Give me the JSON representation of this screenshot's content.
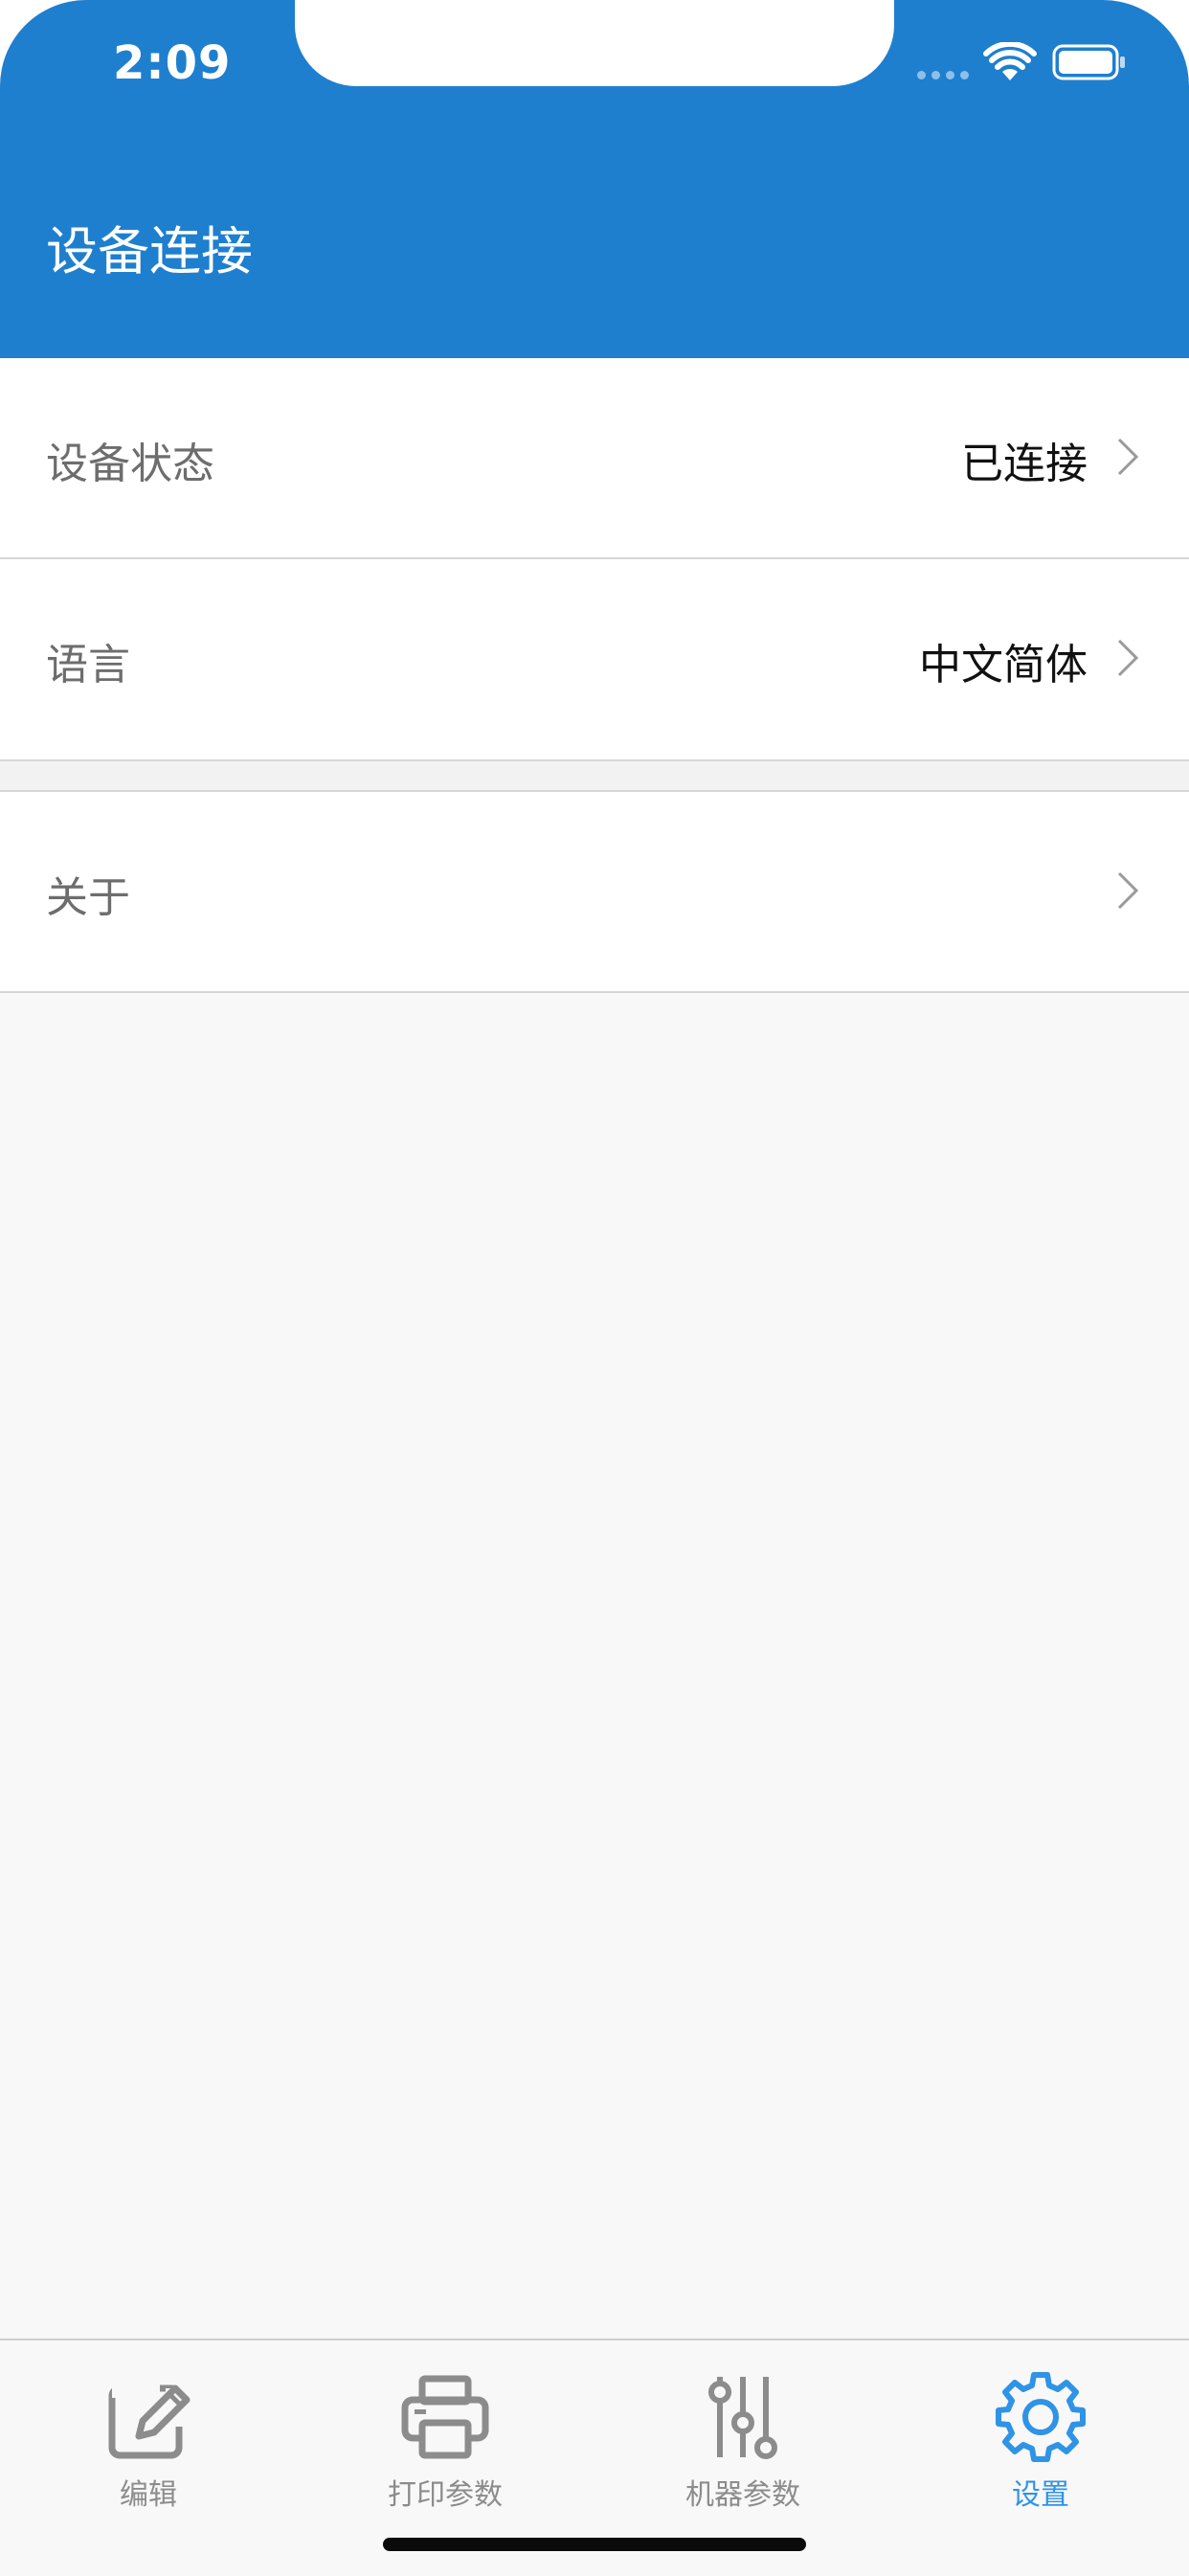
{
  "status_bar": {
    "time": "2:09"
  },
  "header": {
    "title": "设备连接"
  },
  "settings": {
    "rows": [
      {
        "label": "设备状态",
        "value": "已连接"
      },
      {
        "label": "语言",
        "value": "中文简体"
      },
      {
        "label": "关于",
        "value": ""
      }
    ]
  },
  "tabbar": {
    "tabs": [
      {
        "label": "编辑",
        "icon": "edit-icon",
        "active": false
      },
      {
        "label": "打印参数",
        "icon": "printer-icon",
        "active": false
      },
      {
        "label": "机器参数",
        "icon": "sliders-icon",
        "active": false
      },
      {
        "label": "设置",
        "icon": "gear-icon",
        "active": true
      }
    ]
  },
  "colors": {
    "header_bg": "#1e7fcf",
    "active_tab": "#2f93e6",
    "inactive_tab": "#8c8c8c"
  }
}
